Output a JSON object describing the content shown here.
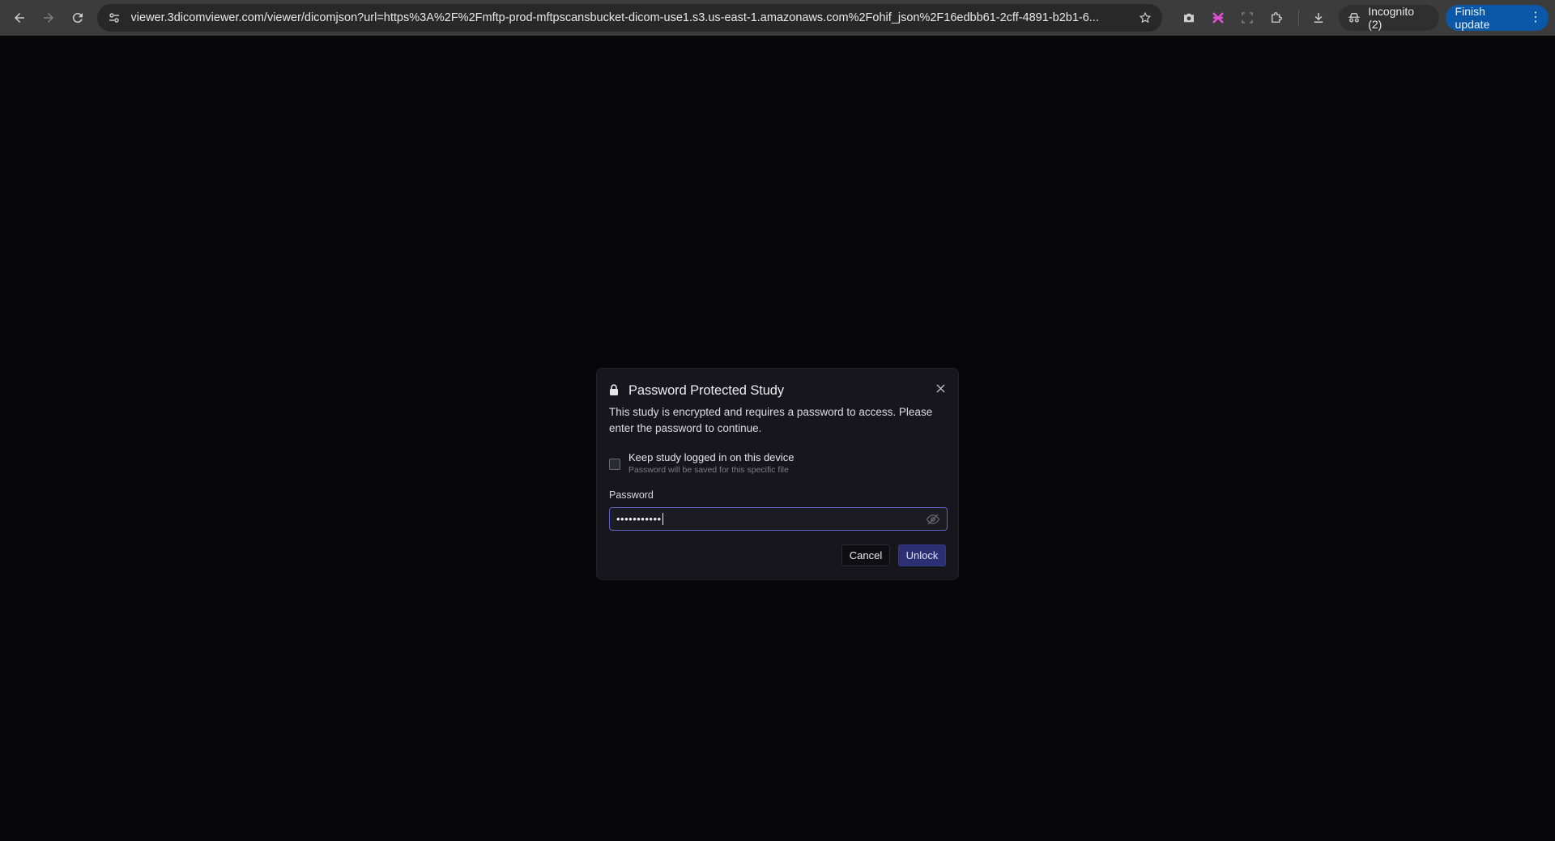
{
  "browser": {
    "url": "viewer.3dicomviewer.com/viewer/dicomjson?url=https%3A%2F%2Fmftp-prod-mftpscansbucket-dicom-use1.s3.us-east-1.amazonaws.com%2Fohif_json%2F16edbb61-2cff-4891-b2b1-6...",
    "incognito_label": "Incognito (2)",
    "finish_update_label": "Finish update",
    "icons": {
      "back": "back-arrow-icon",
      "forward": "forward-arrow-icon",
      "reload": "reload-icon",
      "site_info": "site-info-icon",
      "bookmark": "star-icon",
      "camera": "camera-icon",
      "extension_pink": "pink-extension-icon",
      "screenshot": "screenshot-icon",
      "extensions": "puzzle-icon",
      "download": "download-icon",
      "incognito": "incognito-icon",
      "menu": "kebab-menu-icon"
    },
    "colors": {
      "toolbar": "#3c3c3c",
      "omnibox": "#282828",
      "finish_update": "#0b57a8"
    }
  },
  "dialog": {
    "title": "Password Protected Study",
    "description": "This study is encrypted and requires a password to access. Please enter the password to continue.",
    "keep_logged_in": {
      "label": "Keep study logged in on this device",
      "hint": "Password will be saved for this specific file",
      "checked": false
    },
    "password": {
      "label": "Password",
      "masked_value": "•••••••••••",
      "visibility_icon": "eye-off-icon"
    },
    "buttons": {
      "cancel": "Cancel",
      "unlock": "Unlock"
    },
    "colors": {
      "background": "#17161d",
      "focus_border": "#5f63c9",
      "primary_button": "#2c3072"
    }
  }
}
